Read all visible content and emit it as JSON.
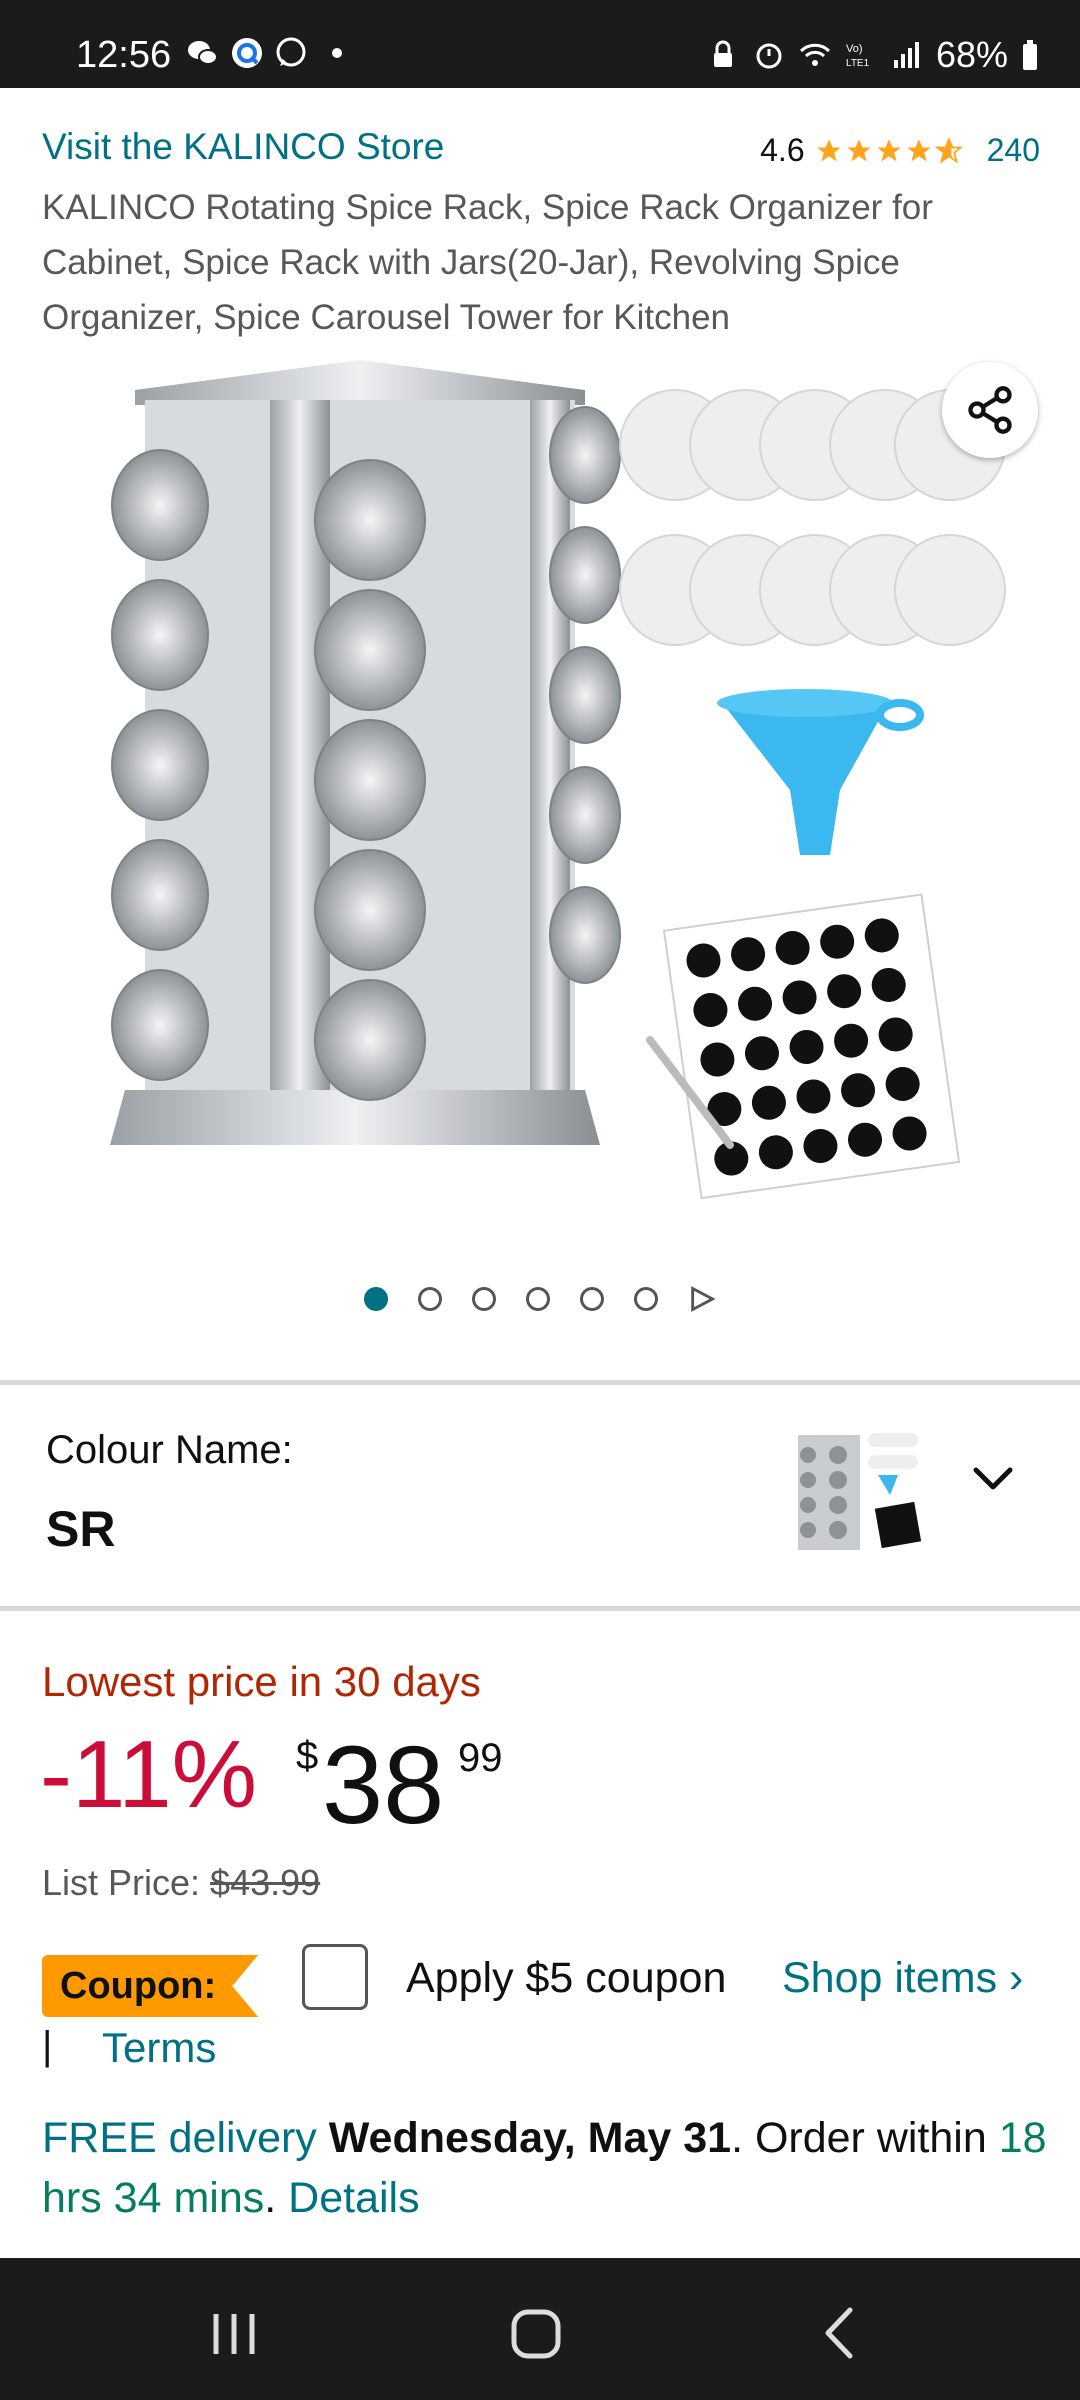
{
  "status_bar": {
    "time": "12:56",
    "battery": "68%",
    "icons_left": [
      "wechat-icon",
      "q-app-icon",
      "whatsapp-icon",
      "notification-dot"
    ],
    "icons_right": [
      "lock-icon",
      "alarm-icon",
      "wifi-icon",
      "volte-icon",
      "signal-icon",
      "battery-icon"
    ]
  },
  "header": {
    "store_link": "Visit the KALINCO Store",
    "rating_value": "4.6",
    "rating_count": "240",
    "rating_stars": 4.6
  },
  "product": {
    "title": "KALINCO Rotating Spice Rack, Spice Rack Organizer for Cabinet, Spice Rack with Jars(20-Jar), Revolving Spice Organizer, Spice Carousel Tower for Kitchen",
    "image_count": 6,
    "active_image": 1
  },
  "colour": {
    "label": "Colour Name:",
    "value": "SR"
  },
  "price": {
    "lowest_label": "Lowest price in 30 days",
    "discount": "-11%",
    "symbol": "$",
    "whole": "38",
    "fraction": "99",
    "list_label": "List Price: ",
    "list_value": "$43.99"
  },
  "coupon": {
    "badge": "Coupon:",
    "apply_text": "Apply $5 coupon",
    "shop_items": "Shop items ›",
    "separator": "|",
    "terms": "Terms"
  },
  "delivery": {
    "free_label": "FREE delivery",
    "date": "Wednesday, May 31",
    "order_within": ". Order within",
    "time_left": "18 hrs 34 mins",
    "period": ".",
    "details": "Details"
  },
  "colors": {
    "link": "#007185",
    "deal_red": "#cc0c39",
    "coupon_orange": "#ff9900",
    "star_orange": "#ffa41c",
    "timer_green": "#067d62"
  }
}
